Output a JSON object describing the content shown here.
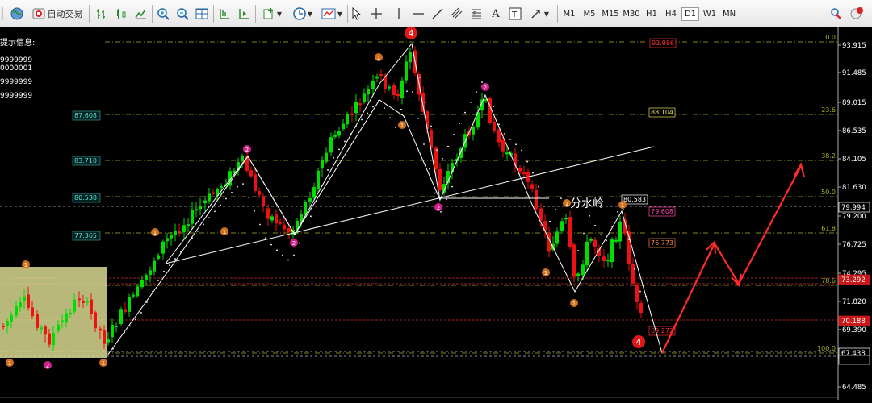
{
  "toolbar": {
    "auto_trading_label": "自动交易",
    "timeframes": [
      "M1",
      "M5",
      "M15",
      "M30",
      "H1",
      "H4",
      "D1",
      "W1",
      "MN"
    ],
    "active_timeframe": "D1"
  },
  "info_panel": {
    "title": "提示信息:",
    "values": [
      "9999999",
      "0000001",
      "9999999",
      "9999999"
    ]
  },
  "chart_data": {
    "type": "candlestick",
    "price_axis": {
      "ticks": [
        "93.915",
        "91.485",
        "89.015",
        "86.535",
        "84.105",
        "81.630",
        "79.200",
        "76.725",
        "74.295",
        "71.820",
        "69.390",
        "66.894",
        "64.485"
      ]
    },
    "price_markers": [
      {
        "text": "79.994",
        "color": "#ffffff"
      },
      {
        "text": "73.292",
        "color": "#ff2020"
      },
      {
        "text": "70.188",
        "color": "#ff2020"
      },
      {
        "text": "67.438",
        "color": "#ffffff"
      }
    ],
    "fib_levels": [
      "0.0",
      "23.6",
      "38.2",
      "50.0",
      "61.8",
      "78.6",
      "100.0"
    ],
    "left_level_labels": [
      "87.608",
      "83.710",
      "80.538",
      "77.365"
    ],
    "right_level_labels": [
      {
        "text": "93.986",
        "color": "#ff3030"
      },
      {
        "text": "88.104",
        "color": "#e8e060"
      },
      {
        "text": "80.583",
        "color": "#ffffff"
      },
      {
        "text": "79.608",
        "color": "#ff44aa"
      },
      {
        "text": "76.773",
        "color": "#ff8844"
      },
      {
        "text": "69.272",
        "color": "#ff3030"
      }
    ],
    "annotation": "分水岭",
    "wave_labels": {
      "top": "4",
      "bottom": "4",
      "two": "2",
      "one": "1"
    },
    "colors": {
      "up": "#00dd00",
      "down": "#ee1111",
      "trend": "#ffffff",
      "forecast": "#ff2a2a",
      "fib": "#b0b020"
    }
  }
}
